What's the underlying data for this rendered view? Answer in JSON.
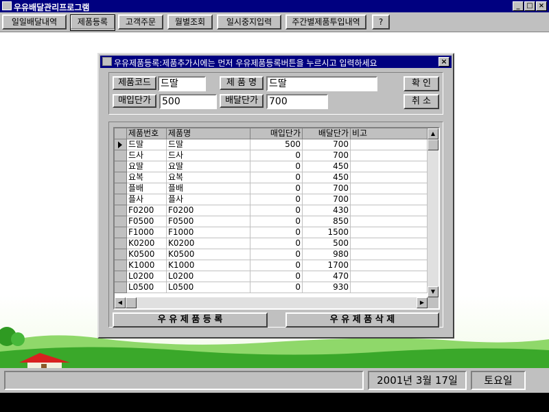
{
  "window": {
    "title": "우유배달관리프로그램",
    "min_label": "_",
    "max_label": "□",
    "close_label": "×"
  },
  "toolbar": {
    "buttons": [
      {
        "label": "일일배달내역"
      },
      {
        "label": "제품등록"
      },
      {
        "label": "고객주문"
      },
      {
        "label": "월별조회"
      },
      {
        "label": "일시중지입력"
      },
      {
        "label": "주간별제품투입내역"
      },
      {
        "label": "?"
      }
    ],
    "active_index": 1
  },
  "dialog": {
    "title": "우유제품등록:제품추가시에는 먼저 우유제품등록버튼을 누르시고 입력하세요",
    "close_label": "×",
    "form": {
      "code_label": "제품코드",
      "code_value": "드딸",
      "name_label": "제 품 명",
      "name_value": "드딸",
      "buy_label": "매입단가",
      "buy_value": "500",
      "sell_label": "배달단가",
      "sell_value": "700",
      "ok_label": "확 인",
      "cancel_label": "취 소"
    },
    "grid": {
      "headers": [
        "제품번호",
        "제품명",
        "매입단가",
        "배달단가",
        "비고"
      ],
      "rows": [
        [
          "드딸",
          "드딸",
          "500",
          "700",
          ""
        ],
        [
          "드사",
          "드사",
          "0",
          "700",
          ""
        ],
        [
          "요딸",
          "요딸",
          "0",
          "450",
          ""
        ],
        [
          "요복",
          "요복",
          "0",
          "450",
          ""
        ],
        [
          "플배",
          "플배",
          "0",
          "700",
          ""
        ],
        [
          "플사",
          "플사",
          "0",
          "700",
          ""
        ],
        [
          "F0200",
          "F0200",
          "0",
          "430",
          ""
        ],
        [
          "F0500",
          "F0500",
          "0",
          "850",
          ""
        ],
        [
          "F1000",
          "F1000",
          "0",
          "1500",
          ""
        ],
        [
          "K0200",
          "K0200",
          "0",
          "500",
          ""
        ],
        [
          "K0500",
          "K0500",
          "0",
          "980",
          ""
        ],
        [
          "K1000",
          "K1000",
          "0",
          "1700",
          ""
        ],
        [
          "L0200",
          "L0200",
          "0",
          "470",
          ""
        ],
        [
          "L0500",
          "L0500",
          "0",
          "930",
          ""
        ]
      ],
      "current_row_index": 0
    },
    "register_button": "우 유 제 품 등 록",
    "delete_button": "우 유 제 품 삭 제"
  },
  "status": {
    "message": "",
    "date": "2001년  3월  17일",
    "weekday": "토요일"
  },
  "colors": {
    "titlebar": "#000080",
    "face": "#c0c0c0",
    "grass": "#3aa82a",
    "roof": "#d82020"
  }
}
